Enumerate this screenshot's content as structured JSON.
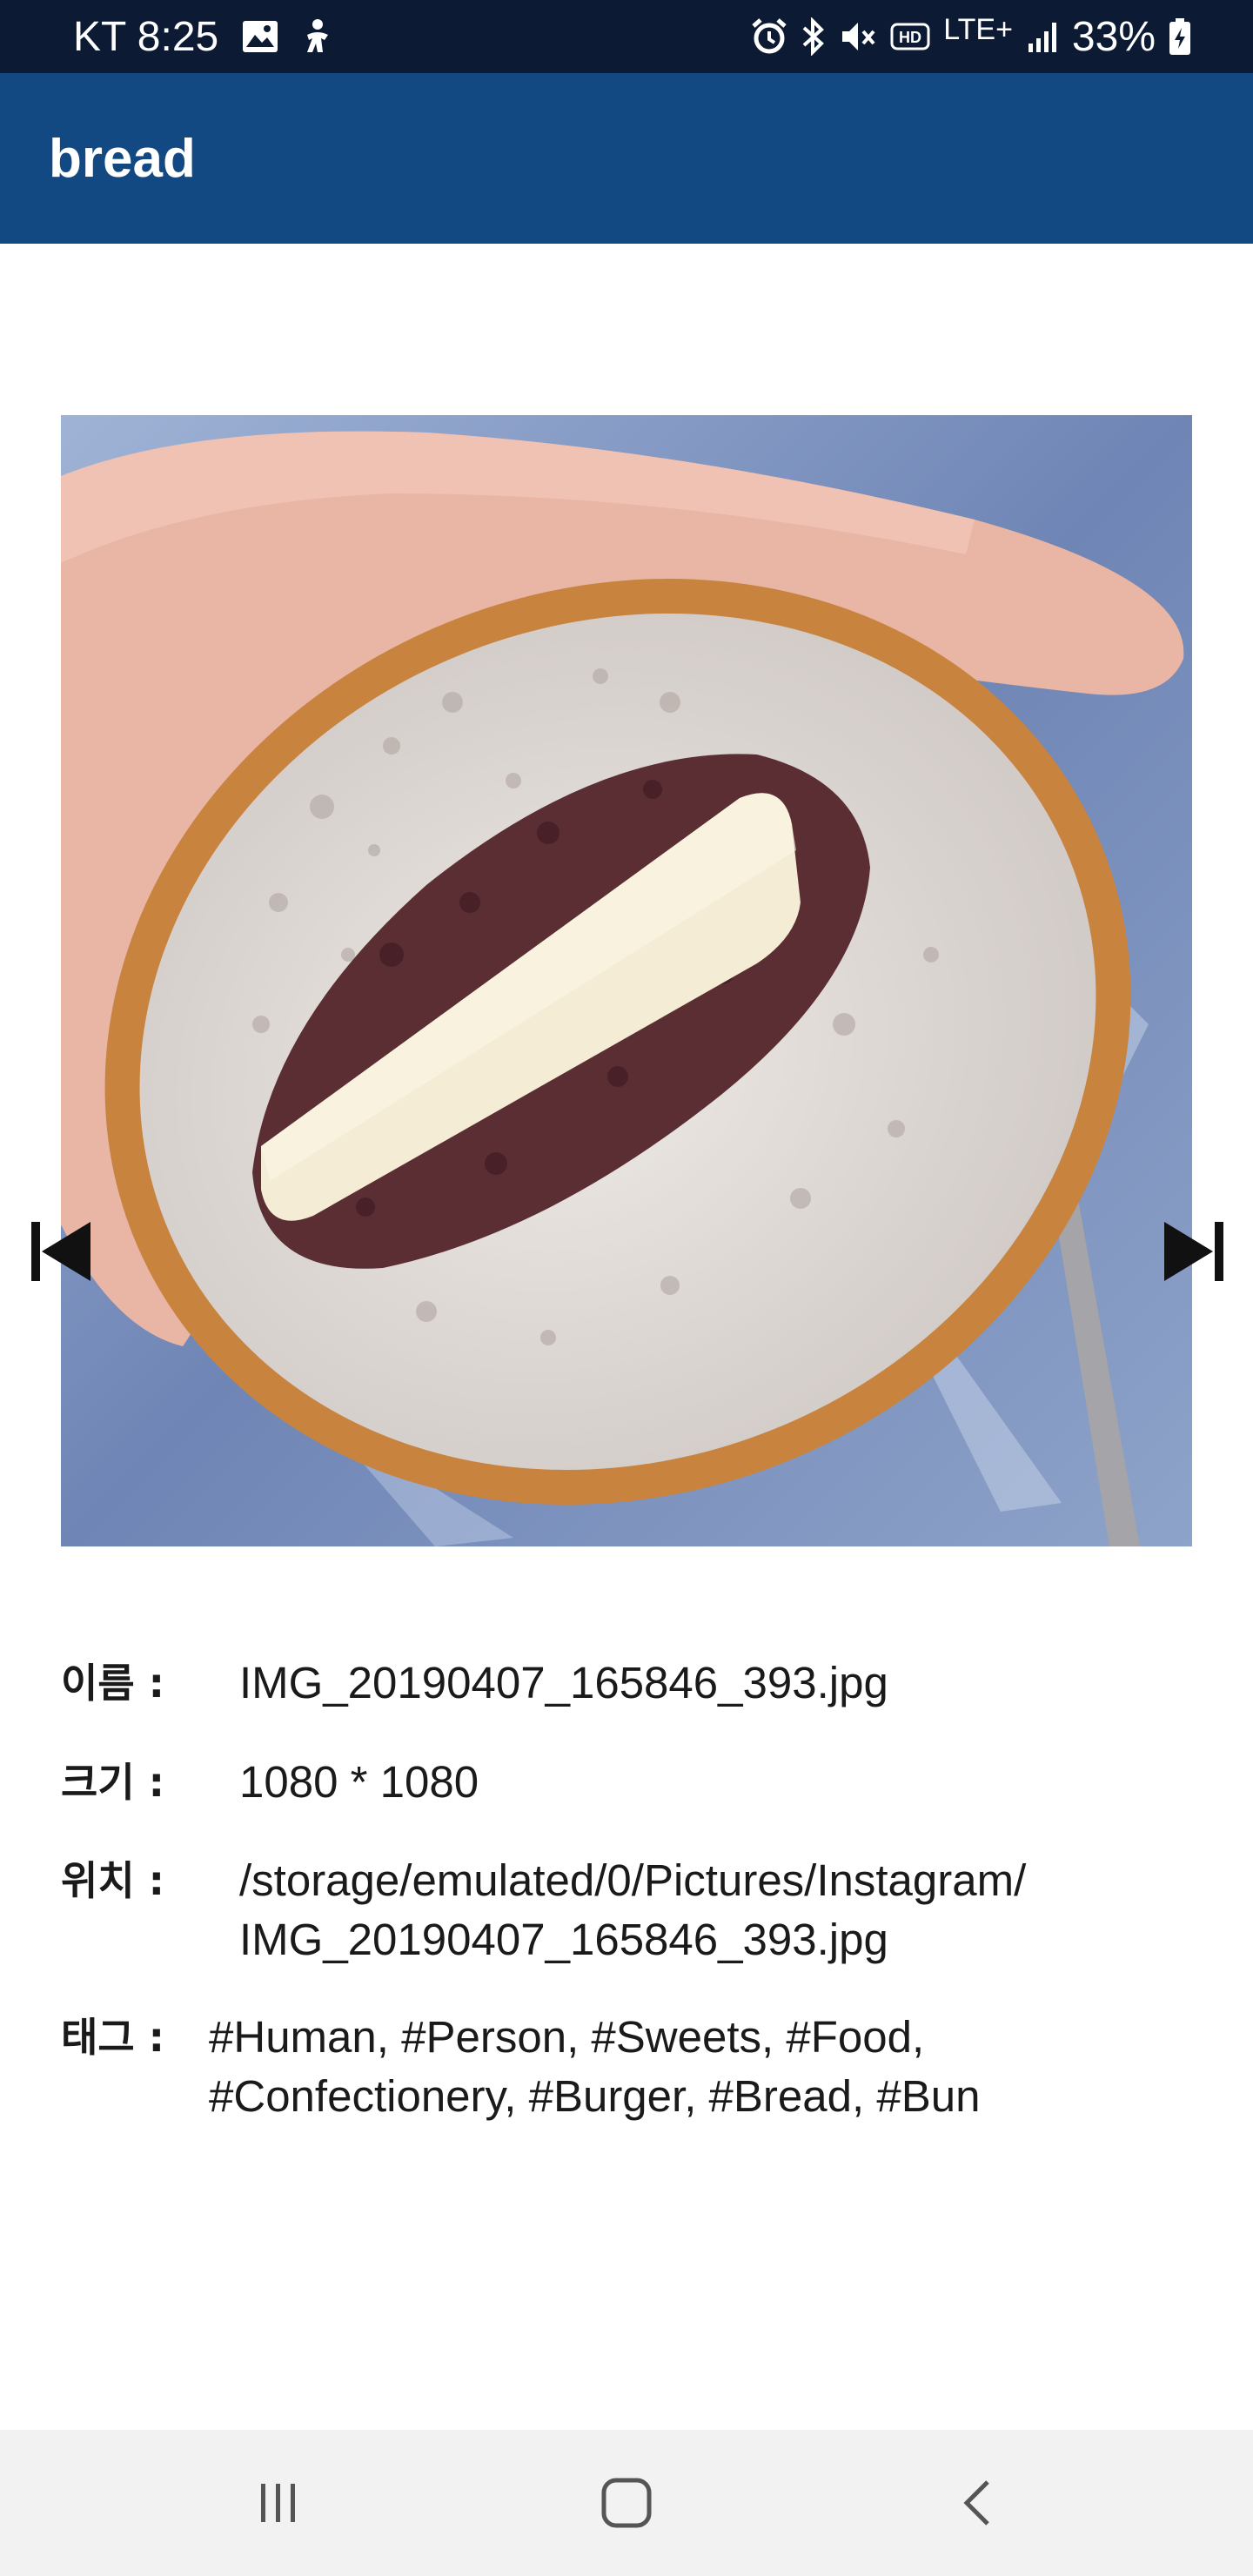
{
  "status_bar": {
    "carrier_time": "KT 8:25",
    "network": "LTE+",
    "battery_percent": "33%",
    "left_icons": [
      "gallery-icon",
      "accessibility-icon"
    ],
    "right_icons": [
      "alarm-icon",
      "bluetooth-icon",
      "mute-icon",
      "hd-voice-icon",
      "signal-icon",
      "battery-charging-icon"
    ]
  },
  "app_bar": {
    "title": "bread"
  },
  "viewer": {
    "prev_icon": "skip-previous-icon",
    "next_icon": "skip-next-icon"
  },
  "info": {
    "name_label": "이름 :",
    "name_value": "IMG_20190407_165846_393.jpg",
    "size_label": "크기 :",
    "size_value": "1080 * 1080",
    "location_label": "위치 :",
    "location_value": "/storage/emulated/0/Pictures/Instagram/\nIMG_20190407_165846_393.jpg",
    "tags_label": "태그 :",
    "tags_value": "#Human, #Person, #Sweets, #Food,\n#Confectionery, #Burger, #Bread, #Bun"
  },
  "nav_bar": {
    "recents_icon": "recents-icon",
    "home_icon": "home-icon",
    "back_icon": "back-icon"
  },
  "colors": {
    "status_bar": "#0c1b33",
    "app_bar": "#124983",
    "nav_bar": "#f2f2f2"
  }
}
